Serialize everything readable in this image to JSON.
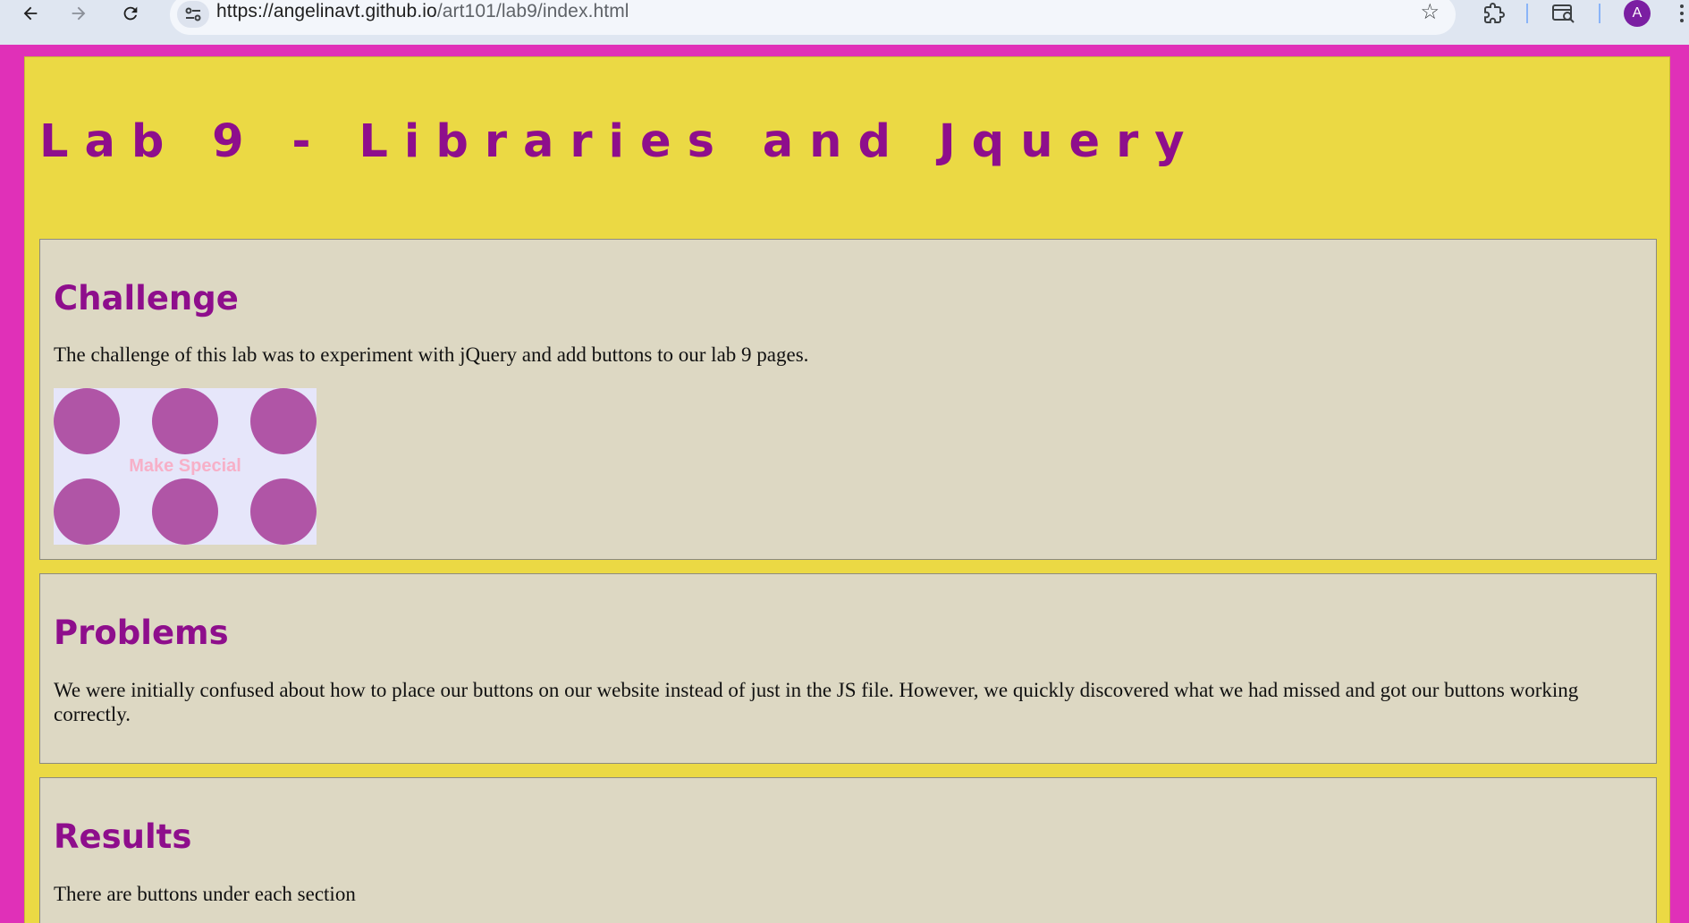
{
  "browser": {
    "url_host": "https://angelinavt.github.io",
    "url_path": "/art101/lab9/index.html",
    "avatar_letter": "A"
  },
  "page": {
    "title": "Lab 9 - Libraries and Jquery",
    "sections": [
      {
        "heading": "Challenge",
        "text": "The challenge of this lab was to experiment with jQuery and add buttons to our lab 9 pages.",
        "button_label": "Make Special"
      },
      {
        "heading": "Problems",
        "text": "We were initially confused about how to place our buttons on our website instead of just in the JS file. However, we quickly discovered what we had missed and got our buttons working correctly."
      },
      {
        "heading": "Results",
        "text": "There are buttons under each section"
      }
    ]
  },
  "colors": {
    "page_background": "#e030b8",
    "container_background": "#ebd944",
    "section_background": "#ddd8c3",
    "heading_color": "#8e0e8c",
    "circle_color": "#b055a6",
    "button_text_color": "#f7b0c8"
  }
}
